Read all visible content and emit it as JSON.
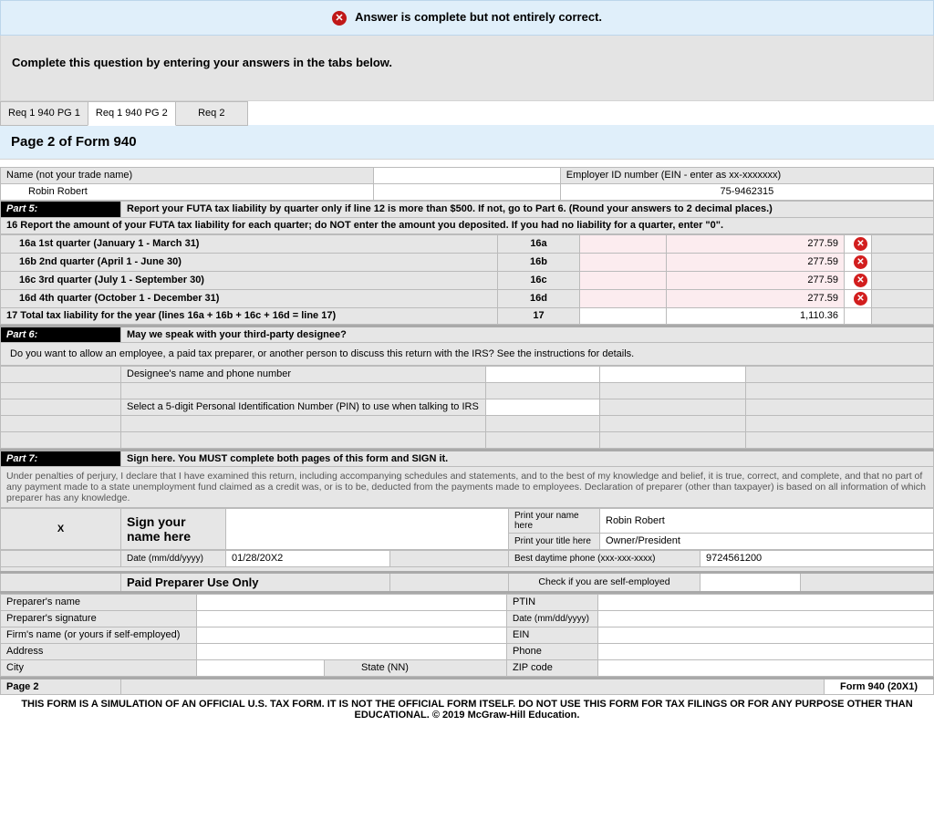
{
  "alert": {
    "text": "Answer is complete but not entirely correct."
  },
  "instruction": "Complete this question by entering your answers in the tabs below.",
  "tabs": [
    {
      "label": "Req 1 940 PG 1"
    },
    {
      "label": "Req 1 940 PG 2"
    },
    {
      "label": "Req 2"
    }
  ],
  "page_title": "Page 2 of Form 940",
  "header": {
    "name_label": "Name (not your trade name)",
    "name_value": "Robin Robert",
    "ein_label": "Employer ID number (EIN - enter as xx-xxxxxxx)",
    "ein_value": "75-9462315"
  },
  "part5": {
    "label": "Part 5:",
    "title": "Report your FUTA tax liability by quarter only if line 12 is more than $500. If not, go to Part 6. (Round your answers to 2 decimal places.)",
    "line16_instruction": "16 Report the amount of your FUTA tax liability for each quarter; do NOT enter the amount you deposited.  If you had no liability for a quarter, enter \"0\".",
    "rows": [
      {
        "label": "16a   1st quarter (January 1 - March 31)",
        "code": "16a",
        "value": "277.59"
      },
      {
        "label": "16b  2nd quarter (April 1 - June 30)",
        "code": "16b",
        "value": "277.59"
      },
      {
        "label": "16c  3rd quarter (July 1 - September 30)",
        "code": "16c",
        "value": "277.59"
      },
      {
        "label": "16d  4th quarter (October 1 - December 31)",
        "code": "16d",
        "value": "277.59"
      }
    ],
    "total_label": "17 Total tax liability for the year (lines 16a + 16b + 16c + 16d = line 17)",
    "total_code": "17",
    "total_value": "1,110.36"
  },
  "part6": {
    "label": "Part 6:",
    "title": "May we speak with your third-party designee?",
    "question": "Do you want to allow an employee, a paid tax preparer, or another person to discuss this return with the IRS?  See the instructions for details.",
    "designee_label": "Designee's name and phone number",
    "pin_label": "Select a 5-digit Personal Identification Number (PIN) to use when talking to IRS"
  },
  "part7": {
    "label": "Part 7:",
    "title": "Sign here. You MUST complete both pages of this form and SIGN it.",
    "perjury": "Under penalties of perjury, I declare that I have examined this return, including accompanying schedules and statements, and to the best of my knowledge and belief, it is true, correct, and complete, and that no part of any payment made to a state unemployment fund claimed as a credit was, or is to be, deducted from the payments made to employees.  Declaration of preparer (other than taxpayer) is based on all information of which preparer has any knowledge.",
    "sign_x": "X",
    "sign_label": "Sign your name here",
    "print_name_label": "Print your name here",
    "print_name_value": "Robin Robert",
    "print_title_label": "Print your title here",
    "print_title_value": "Owner/President",
    "date_label": "Date (mm/dd/yyyy)",
    "date_value": "01/28/20X2",
    "phone_label": "Best daytime phone (xxx-xxx-xxxx)",
    "phone_value": "9724561200",
    "paid_preparer_label": "Paid Preparer Use Only",
    "self_emp_label": "Check if you are self-employed",
    "preparer_name": "Preparer's name",
    "ptin": "PTIN",
    "preparer_sig": "Preparer's signature",
    "preparer_date": "Date (mm/dd/yyyy)",
    "firm_name": "Firm's name (or yours if self-employed)",
    "ein_lbl": "EIN",
    "address": "Address",
    "phone_lbl": "Phone",
    "city": "City",
    "state": "State (NN)",
    "zip": "ZIP code",
    "page2": "Page 2",
    "form_rev": "Form 940 (20X1)"
  },
  "disclaimer": "THIS FORM IS A SIMULATION OF AN OFFICIAL U.S. TAX FORM. IT IS NOT THE OFFICIAL FORM ITSELF. DO NOT USE THIS FORM FOR TAX FILINGS OR FOR ANY PURPOSE OTHER THAN EDUCATIONAL. © 2019 McGraw-Hill Education."
}
